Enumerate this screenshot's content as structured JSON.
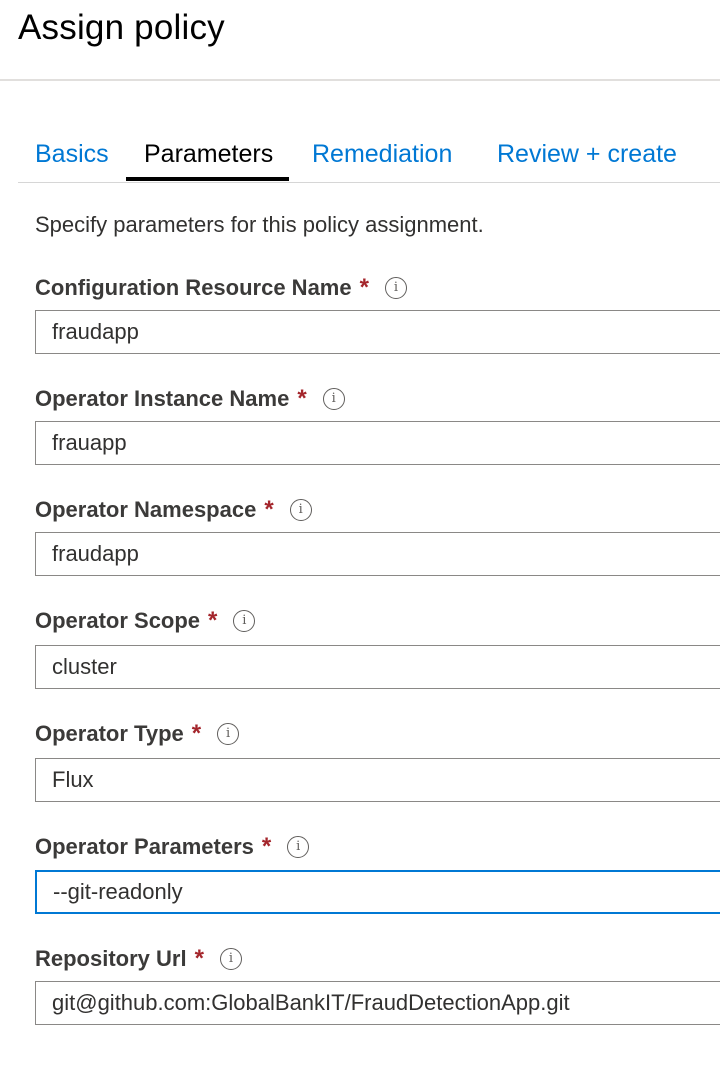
{
  "header": {
    "title": "Assign policy"
  },
  "tabs": [
    {
      "label": "Basics"
    },
    {
      "label": "Parameters"
    },
    {
      "label": "Remediation"
    },
    {
      "label": "Review + create"
    }
  ],
  "description": "Specify parameters for this policy assignment.",
  "required_marker": "*",
  "info_glyph": "i",
  "fields": [
    {
      "label": "Configuration Resource Name",
      "value": "fraudapp"
    },
    {
      "label": "Operator Instance Name",
      "value": "frauapp"
    },
    {
      "label": "Operator Namespace",
      "value": "fraudapp"
    },
    {
      "label": "Operator Scope",
      "value": "cluster"
    },
    {
      "label": "Operator Type",
      "value": "Flux"
    },
    {
      "label": "Operator Parameters",
      "value": "--git-readonly"
    },
    {
      "label": "Repository Url",
      "value": "git@github.com:GlobalBankIT/FraudDetectionApp.git"
    }
  ],
  "colors": {
    "accent": "#0078d4",
    "required": "#a4262c",
    "border": "#8a8886"
  }
}
